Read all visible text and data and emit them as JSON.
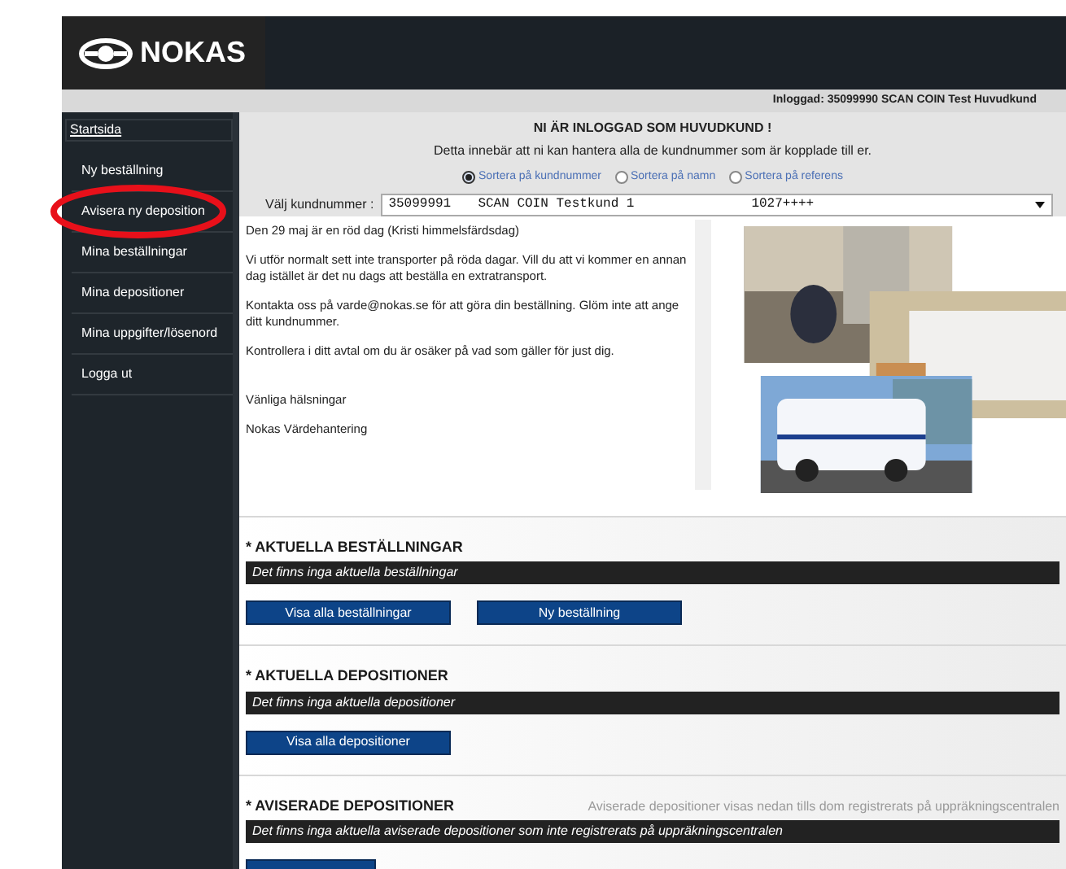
{
  "header": {
    "logo_text": "NOKAS",
    "login_info": "Inloggad: 35099990 SCAN COIN Test Huvudkund"
  },
  "sidebar": {
    "items": [
      {
        "label": "Startsida",
        "kind": "link"
      },
      {
        "label": "Ny beställning",
        "kind": "item"
      },
      {
        "label": "Avisera ny deposition",
        "kind": "item",
        "circled": true
      },
      {
        "label": "Mina beställningar",
        "kind": "item"
      },
      {
        "label": "Mina depositioner",
        "kind": "item"
      },
      {
        "label": "Mina uppgifter/lösenord",
        "kind": "item"
      },
      {
        "label": "Logga ut",
        "kind": "item"
      }
    ]
  },
  "customer_panel": {
    "title": "NI ÄR INLOGGAD SOM HUVUDKUND !",
    "subtitle": "Detta innebär att ni kan hantera alla de kundnummer som är kopplade till er.",
    "sort_options": [
      {
        "label": "Sortera på kundnummer",
        "selected": true
      },
      {
        "label": "Sortera på namn",
        "selected": false
      },
      {
        "label": "Sortera på referens",
        "selected": false
      }
    ],
    "select_label": "Välj kundnummer :",
    "select_value": {
      "number": "35099991",
      "name": "SCAN COIN Testkund 1",
      "ref": "1027++++"
    }
  },
  "message": {
    "paragraphs": [
      "Den 29 maj är en röd dag (Kristi himmelsfärdsdag)",
      "Vi utför normalt sett inte transporter på röda dagar. Vill du att vi kommer en annan dag istället är det nu dags att beställa en extratransport.",
      "Kontakta oss på varde@nokas.se för att göra din beställning. Glöm inte att ange ditt kundnummer.",
      "Kontrollera i ditt avtal om du är osäker på vad som gäller för just dig.",
      "Vänliga hälsningar",
      "Nokas Värdehantering"
    ]
  },
  "sections": [
    {
      "title": "* AKTUELLA BESTÄLLNINGAR",
      "empty_message": "Det finns inga aktuella beställningar",
      "buttons": [
        "Visa alla beställningar",
        "Ny beställning"
      ]
    },
    {
      "title": "* AKTUELLA DEPOSITIONER",
      "empty_message": "Det finns inga aktuella depositioner",
      "buttons": [
        "Visa alla depositioner"
      ]
    },
    {
      "title": "* AVISERADE DEPOSITIONER",
      "note": "Aviserade depositioner visas nedan tills dom registrerats på uppräkningscentralen",
      "empty_message": "Det finns inga aktuella aviserade depositioner som inte registrerats på uppräkningscentralen",
      "partial_button": true
    }
  ]
}
